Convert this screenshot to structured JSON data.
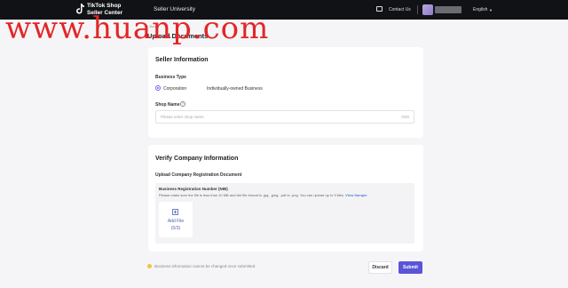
{
  "topbar": {
    "logo_line1": "TikTok Shop",
    "logo_line2": "Seller Center",
    "section": "Seller University",
    "contact": "Contact Us",
    "language": "English"
  },
  "watermark": "www.huanp.com",
  "breadcrumb": "< Back",
  "page_title": "Upload Documents",
  "seller_info": {
    "title": "Seller Information",
    "business_type_label": "Business Type",
    "options": [
      "Corporation",
      "Individually-owned Business"
    ],
    "selected": "Corporation",
    "shop_name_label": "Shop Name",
    "shop_name_placeholder": "Please enter shop name",
    "shop_name_count": "0/30"
  },
  "verify": {
    "title": "Verify Company Information",
    "upload_label": "Upload Company Registration Document",
    "doc_title": "Business Registration Number (NIB)",
    "hint": "Please make sure the file is less than 10 MB and the file format is .jpg, .jpeg, .pdf or .png. You can upload up to 3 files.",
    "hint_link": "View Sample",
    "add_file": "Add File",
    "file_count": "(0/3)"
  },
  "footer": {
    "note": "Business information cannot be changed once submitted.",
    "discard": "Discard",
    "submit": "Submit"
  },
  "colors": {
    "accent": "#5a55d6",
    "topbar": "#111216",
    "watermark": "#e32626"
  }
}
